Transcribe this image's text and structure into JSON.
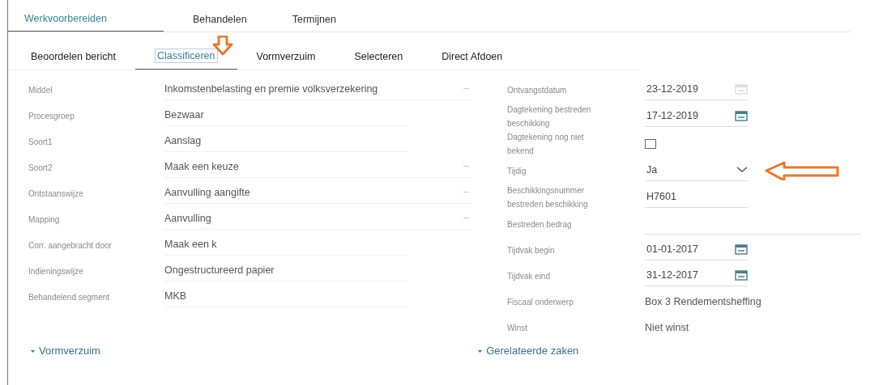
{
  "main_tabs": [
    {
      "label": "Werkvoorbereiden",
      "selected": true
    },
    {
      "label": "Behandelen",
      "selected": false
    },
    {
      "label": "Termijnen",
      "selected": false
    }
  ],
  "sub_tabs": [
    {
      "label": "Beoordelen bericht",
      "selected": false
    },
    {
      "label": "Classificeren",
      "selected": true
    },
    {
      "label": "Vormverzuim",
      "selected": false
    },
    {
      "label": "Selecteren",
      "selected": false
    },
    {
      "label": "Direct Afdoen",
      "selected": false
    }
  ],
  "left_fields": [
    {
      "label": "Middel",
      "kind": "select",
      "value": "Inkomstenbelasting en premie volksverzekering"
    },
    {
      "label": "Procesgroep",
      "kind": "text",
      "value": "Bezwaar"
    },
    {
      "label": "Soort1",
      "kind": "text",
      "value": "Aanslag"
    },
    {
      "label": "Soort2",
      "kind": "select",
      "value": "Maak een keuze"
    },
    {
      "label": "Ontstaanswijze",
      "kind": "select",
      "value": "Aanvulling aangifte"
    },
    {
      "label": "Mapping",
      "kind": "select",
      "value": "Aanvulling"
    },
    {
      "label": "Corr. aangebracht door",
      "kind": "text",
      "value": "Maak een k"
    },
    {
      "label": "Indieningswijze",
      "kind": "text",
      "value": "Ongestructureerd papier"
    },
    {
      "label": "Behandelend segment",
      "kind": "text",
      "value": "MKB"
    }
  ],
  "right_fields": [
    {
      "label": "Ontvangstdatum",
      "kind": "date",
      "value": "23-12-2019",
      "disabled": true
    },
    {
      "label": "Dagtekening bestreden beschikking",
      "kind": "date",
      "value": "17-12-2019",
      "disabled": false
    },
    {
      "label": "Dagtekening nog niet bekend",
      "kind": "checkbox",
      "checked": false
    },
    {
      "label": "Tijdig",
      "kind": "select",
      "value": "Ja"
    },
    {
      "label": "Beschikkingsnummer bestreden beschikking",
      "kind": "input",
      "value": "H7601"
    },
    {
      "label": "Bestreden bedrag",
      "kind": "wide-input"
    },
    {
      "label": "Tijdvak begin",
      "kind": "date",
      "value": "01-01-2017",
      "disabled": false
    },
    {
      "label": "Tijdvak eind",
      "kind": "date",
      "value": "31-12-2017",
      "disabled": false
    },
    {
      "label": "Fiscaal onderwerp",
      "kind": "text",
      "value": "Box 3 Rendementsheffing"
    },
    {
      "label": "Winst",
      "kind": "text",
      "value": "Niet winst"
    }
  ],
  "sections": [
    "Vormverzuim",
    "Gerelateerde zaken"
  ]
}
